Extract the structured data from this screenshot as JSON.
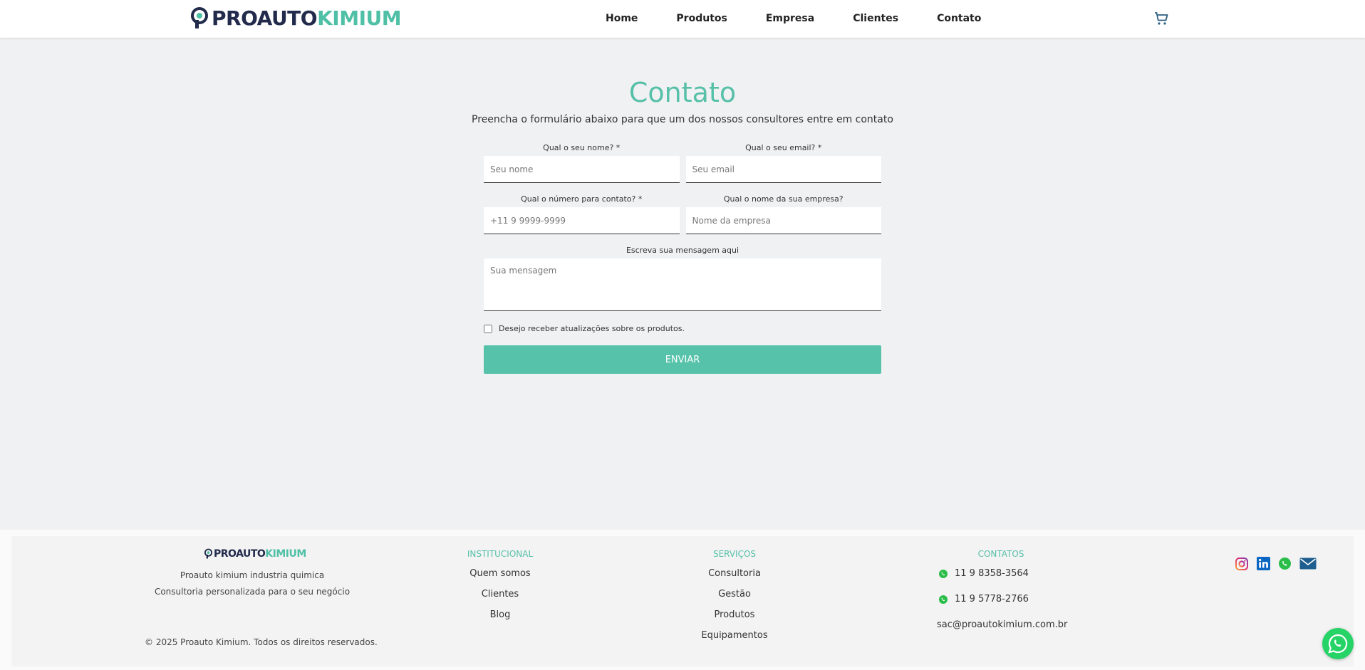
{
  "brand": {
    "part1": "PROAUTO",
    "part2": "KIMIUM",
    "accent": "#4fc0a6",
    "dark": "#232b4d"
  },
  "nav": [
    "Home",
    "Produtos",
    "Empresa",
    "Clientes",
    "Contato"
  ],
  "cart_icon": "shopping-cart-icon",
  "contact": {
    "title": "Contato",
    "subtitle": "Preencha o formulário abaixo para que um dos nossos consultores entre em contato",
    "name_label": "Qual o seu nome? *",
    "name_placeholder": "Seu nome",
    "email_label": "Qual o seu email? *",
    "email_placeholder": "Seu email",
    "phone_label": "Qual o número para contato? *",
    "phone_placeholder": "+11 9 9999-9999",
    "company_label": "Qual o nome da sua empresa?",
    "company_placeholder": "Nome da empresa",
    "message_label": "Escreva sua mensagem aqui",
    "message_placeholder": "Sua mensagem",
    "newsletter_label": "Desejo receber atualizações sobre os produtos.",
    "submit_label": "ENVIAR"
  },
  "footer": {
    "desc_line1": "Proauto kimium industria quimica",
    "desc_line2": "Consultoria personalizada para o seu negócio",
    "copyright": "© 2025 Proauto Kimium. Todos os direitos reservados.",
    "institucional": {
      "title": "INSTITUCIONAL",
      "links": [
        "Quem somos",
        "Clientes",
        "Blog"
      ]
    },
    "servicos": {
      "title": "SERVIÇOS",
      "links": [
        "Consultoria",
        "Gestão",
        "Produtos",
        "Equipamentos"
      ]
    },
    "contatos": {
      "title": "CONTATOS",
      "phone1": "11 9 8358-3564",
      "phone2": "11 9 5778-2766",
      "email": "sac@proautokimium.com.br"
    },
    "socials": [
      "instagram-icon",
      "linkedin-icon",
      "whatsapp-icon",
      "email-icon"
    ]
  }
}
